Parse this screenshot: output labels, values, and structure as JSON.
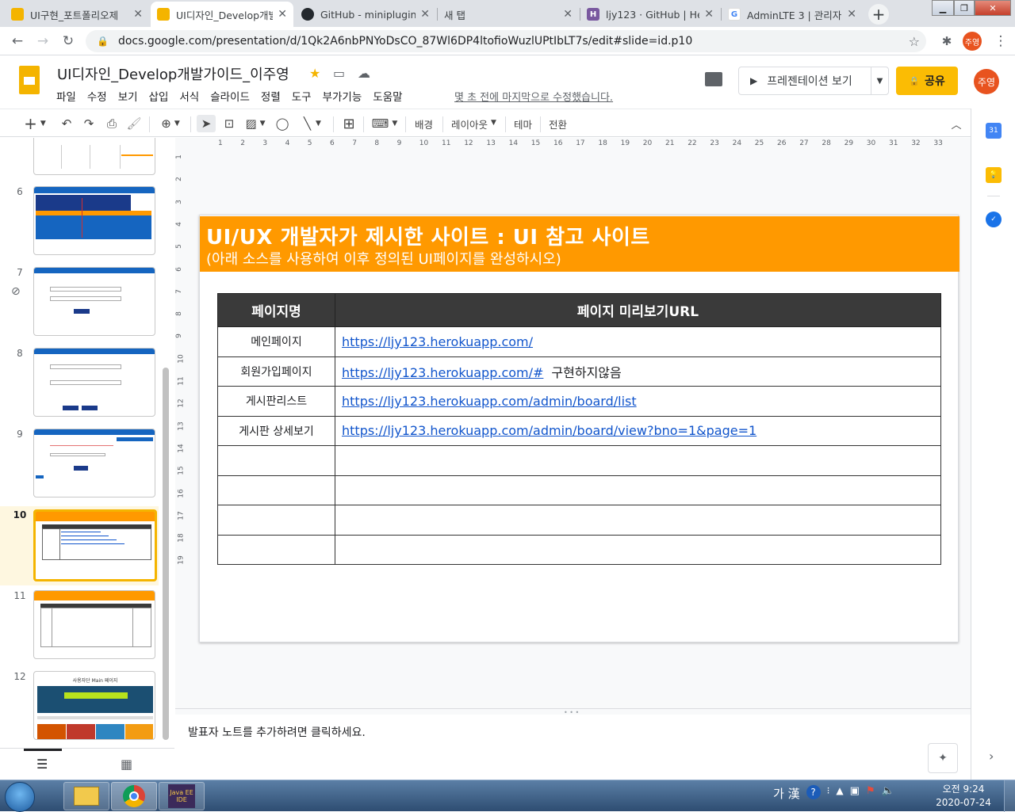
{
  "browser": {
    "tabs": [
      {
        "title": "UI구현_포트폴리오제",
        "icon": "slides-icon",
        "active": false
      },
      {
        "title": "UI디자인_Develop개발",
        "icon": "slides-icon",
        "active": true
      },
      {
        "title": "GitHub - miniplugin/",
        "icon": "github-icon",
        "active": false
      },
      {
        "title": "새 탭",
        "icon": "none",
        "active": false
      },
      {
        "title": "ljy123 · GitHub | Her",
        "icon": "heroku-icon",
        "active": false
      },
      {
        "title": "AdminLTE 3 | 관리자",
        "icon": "google-icon",
        "active": false
      }
    ],
    "url": "docs.google.com/presentation/d/1Qk2A6nbPNYoDsCO_87Wl6DP4ltofioWuzlUPtIbLT7s/edit#slide=id.p10",
    "profile_initials": "주영"
  },
  "doc": {
    "title": "UI디자인_Develop개발가이드_이주영",
    "menu": [
      "파일",
      "수정",
      "보기",
      "삽입",
      "서식",
      "슬라이드",
      "정렬",
      "도구",
      "부가기능",
      "도움말"
    ],
    "last_edit": "몇 초 전에 마지막으로 수정했습니다.",
    "present_label": "프레젠테이션 보기",
    "share_label": "공유",
    "avatar_initials": "주영"
  },
  "toolbar": {
    "background_label": "배경",
    "layout_label": "레이아웃",
    "theme_label": "테마",
    "transition_label": "전환"
  },
  "filmstrip": {
    "slides": [
      {
        "num": "6"
      },
      {
        "num": "7"
      },
      {
        "num": "8"
      },
      {
        "num": "9"
      },
      {
        "num": "10"
      },
      {
        "num": "11"
      },
      {
        "num": "12"
      }
    ],
    "selected": "10",
    "slide12_title": "사용자단 Main 페이지"
  },
  "ruler": {
    "h_ticks": [
      "1",
      "2",
      "3",
      "4",
      "5",
      "6",
      "7",
      "8",
      "9",
      "10",
      "11",
      "12",
      "13",
      "14",
      "15",
      "16",
      "17",
      "18",
      "19",
      "20",
      "21",
      "22",
      "23",
      "24",
      "25",
      "26",
      "27",
      "28",
      "29",
      "30",
      "31",
      "32",
      "33"
    ],
    "v_ticks": [
      "1",
      "2",
      "3",
      "4",
      "5",
      "6",
      "7",
      "8",
      "9",
      "10",
      "11",
      "12",
      "13",
      "14",
      "15",
      "16",
      "17",
      "18",
      "19"
    ]
  },
  "slide": {
    "title": "UI/UX 개발자가 제시한 사이트 : UI 참고 사이트",
    "subtitle": "(아래 소스를 사용하여 이후 정의된 UI페이지를 완성하시오)",
    "table": {
      "headers": [
        "페이지명",
        "페이지 미리보기URL"
      ],
      "rows": [
        {
          "page": "메인페이지",
          "url": "https://ljy123.herokuapp.com/",
          "note": ""
        },
        {
          "page": "회원가입페이지",
          "url": "https://ljy123.herokuapp.com/#",
          "note": "구현하지않음"
        },
        {
          "page": "게시판리스트",
          "url": "https://ljy123.herokuapp.com/admin/board/list",
          "note": ""
        },
        {
          "page": "게시판 상세보기",
          "url": "https://ljy123.herokuapp.com/admin/board/view?bno=1&page=1",
          "note": ""
        },
        {
          "page": "",
          "url": "",
          "note": ""
        },
        {
          "page": "",
          "url": "",
          "note": ""
        },
        {
          "page": "",
          "url": "",
          "note": ""
        },
        {
          "page": "",
          "url": "",
          "note": ""
        }
      ]
    }
  },
  "notes": {
    "placeholder": "발표자 노트를 추가하려면 클릭하세요."
  },
  "sidepanel": {
    "calendar_day": "31"
  },
  "taskbar": {
    "ime": "가 漢",
    "time": "오전 9:24",
    "date": "2020-07-24",
    "eclipse_label": "Java EE IDE"
  },
  "colors": {
    "banner": "#ff9900",
    "table_header": "#3a3a3a",
    "accent_yellow": "#f4b400",
    "link": "#1155cc"
  }
}
